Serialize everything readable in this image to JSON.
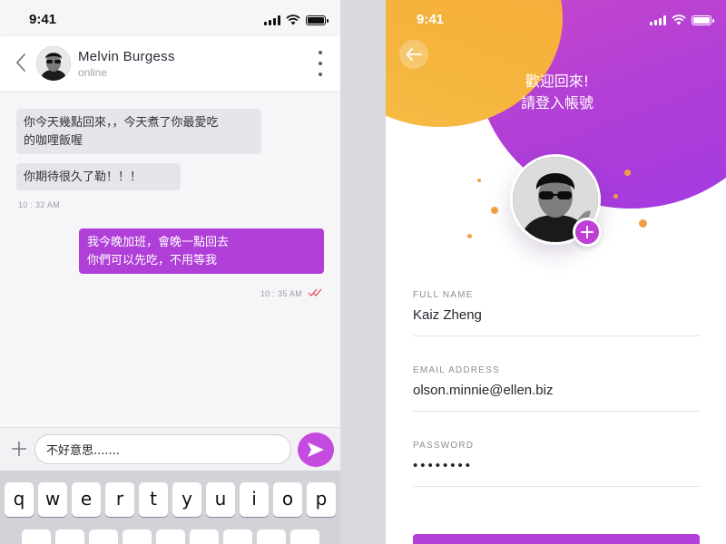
{
  "colors": {
    "accent_purple": "#b03fd8",
    "send_purple": "#c44ae0",
    "orange": "#f5b43d",
    "tick_red": "#e0455b"
  },
  "chat_screen": {
    "status_time": "9:41",
    "contact": {
      "name": "Melvin Burgess",
      "status": "online"
    },
    "messages": [
      {
        "direction": "in",
        "lines": [
          "你今天幾點回來，，今天煮了你最愛吃",
          "的咖哩飯喔"
        ]
      },
      {
        "direction": "in",
        "lines": [
          "你期待很久了勒！！！"
        ]
      },
      {
        "direction": "in",
        "timestamp": "10 : 32 AM"
      },
      {
        "direction": "out",
        "lines": [
          "我今晚加班，會晚一點回去",
          "你們可以先吃，不用等我"
        ]
      },
      {
        "direction": "out",
        "timestamp": "10 : 35 AM",
        "status_icon": "double-check-icon"
      }
    ],
    "composer": {
      "value": "不好意思.......",
      "plus_icon": "plus-icon",
      "send_icon": "send-icon"
    },
    "keyboard_row_1": [
      "q",
      "w",
      "e",
      "r",
      "t",
      "y",
      "u",
      "i",
      "o",
      "p"
    ]
  },
  "login_screen": {
    "status_time": "9:41",
    "back_icon": "arrow-left-icon",
    "welcome_line_1": "歡迎回來!",
    "welcome_line_2": "請登入帳號",
    "add_photo_icon": "plus-icon",
    "fields": [
      {
        "label": "FULL NAME",
        "value": "Kaiz Zheng"
      },
      {
        "label": "EMAIL ADDRESS",
        "value": "olson.minnie@ellen.biz"
      },
      {
        "label": "PASSWORD",
        "value": "••••••••"
      }
    ]
  }
}
